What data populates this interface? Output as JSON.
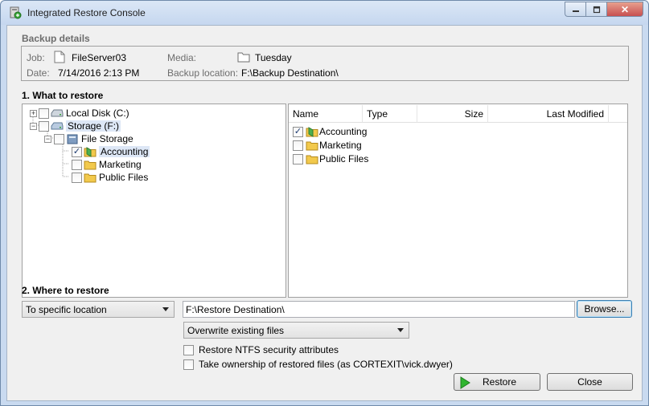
{
  "window": {
    "title": "Integrated Restore Console",
    "close_glyph": "✕"
  },
  "details": {
    "section_title": "Backup details",
    "job_label": "Job:",
    "job_value": "FileServer03",
    "date_label": "Date:",
    "date_value": "7/14/2016 2:13 PM",
    "media_label": "Media:",
    "media_value": "Tuesday",
    "location_label": "Backup location:",
    "location_value": "F:\\Backup Destination\\"
  },
  "what": {
    "section_title": "1. What to restore",
    "tree": [
      {
        "label": "Local Disk (C:)",
        "checked": false,
        "icon": "drive-icon"
      },
      {
        "label": "Storage (F:)",
        "checked": false,
        "icon": "drive-icon"
      },
      {
        "label": "File Storage",
        "checked": false,
        "icon": "share-icon"
      },
      {
        "label": "Accounting",
        "checked": true,
        "icon": "folder-green-icon"
      },
      {
        "label": "Marketing",
        "checked": false,
        "icon": "folder-icon"
      },
      {
        "label": "Public Files",
        "checked": false,
        "icon": "folder-icon"
      }
    ],
    "columns": [
      "Name",
      "Type",
      "Size",
      "Last Modified"
    ],
    "files": [
      {
        "name": "Accounting",
        "checked": true
      },
      {
        "name": "Marketing",
        "checked": false
      },
      {
        "name": "Public Files",
        "checked": false
      }
    ],
    "check_glyph": "✓"
  },
  "where": {
    "section_title": "2. Where to restore",
    "mode_value": "To specific location",
    "path_value": "F:\\Restore Destination\\",
    "browse_label": "Browse...",
    "overwrite_value": "Overwrite existing files",
    "opt_ntfs": "Restore NTFS security attributes",
    "opt_ownership": "Take ownership of restored files (as CORTEXIT\\vick.dwyer)"
  },
  "actions": {
    "restore_label": "Restore",
    "close_label": "Close"
  },
  "colors": {
    "accent": "#3c7fb1",
    "folder_yellow": "#f2c94c",
    "folder_green": "#4caf50",
    "play_green": "#2fb52f"
  }
}
